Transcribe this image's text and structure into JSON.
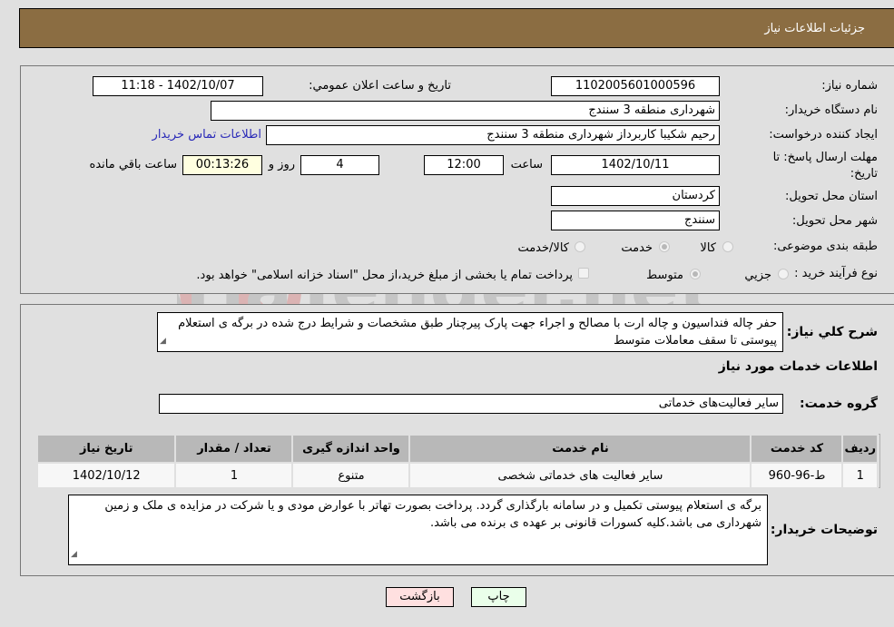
{
  "header": {
    "title": "جزئیات اطلاعات نیاز"
  },
  "fields": {
    "need_number": {
      "label": "شماره نیاز:",
      "value": "1102005601000596"
    },
    "announce": {
      "label": "تاریخ و ساعت اعلان عمومي:",
      "value": "1402/10/07 - 11:18"
    },
    "buyer_org": {
      "label": "نام دستگاه خریدار:",
      "value": "شهرداری منطقه 3 سنندج"
    },
    "requester": {
      "label": "ایجاد کننده درخواست:",
      "value": "رحیم شکیبا کاربرداز شهرداری منطقه 3 سنندج"
    },
    "buyer_contact_link": "اطلاعات تماس خریدار",
    "deadline": {
      "label_line1": "مهلت ارسال پاسخ: تا",
      "label_line2": "تاریخ:",
      "date": "1402/10/11",
      "time_label": "ساعت",
      "time": "12:00",
      "days": "4",
      "days_label": "روز و",
      "remaining": "00:13:26",
      "remaining_label": "ساعت باقي مانده"
    },
    "province": {
      "label": "استان محل تحویل:",
      "value": "کردستان"
    },
    "city": {
      "label": "شهر محل تحویل:",
      "value": "سنندج"
    },
    "category": {
      "label": "طبقه بندی موضوعی:",
      "options": [
        {
          "label": "کالا",
          "checked": false
        },
        {
          "label": "خدمت",
          "checked": true
        },
        {
          "label": "کالا/خدمت",
          "checked": false
        }
      ]
    },
    "process": {
      "label": "نوع فرآیند خرید :",
      "options": [
        {
          "label": "جزيي",
          "checked": false
        },
        {
          "label": "متوسط",
          "checked": true
        }
      ],
      "treasury_checkbox_label": "پرداخت تمام یا بخشی از مبلغ خرید،از محل \"اسناد خزانه اسلامی\" خواهد بود.",
      "treasury_checked": false
    }
  },
  "description": {
    "label": "شرح کلي نیاز:",
    "value": "حفر چاله فنداسیون و چاله ارت با مصالح و اجراء جهت پارک پیرچنار طبق مشخصات و شرایط درج شده در برگه ی استعلام پیوستی تا سقف معاملات متوسط"
  },
  "services_section_title": "اطلاعات خدمات مورد نیاز",
  "service_group": {
    "label": "گروه خدمت:",
    "value": "سایر فعالیت‌های خدماتی"
  },
  "table": {
    "headers": [
      "ردیف",
      "کد خدمت",
      "نام خدمت",
      "واحد اندازه گیری",
      "تعداد / مقدار",
      "تاریخ نیاز"
    ],
    "rows": [
      [
        "1",
        "ط-96-960",
        "سایر فعالیت های خدماتی شخصی",
        "متنوع",
        "1",
        "1402/10/12"
      ]
    ]
  },
  "buyer_notes": {
    "label": "توضیحات خریدار:",
    "value": "برگه ی استعلام پیوستی تکمیل و در سامانه بارگذاری گردد. پرداخت بصورت تهاتر با عوارض مودی و یا شرکت در مزایده ی ملک و زمین شهرداری می باشد.کلیه کسورات قانونی بر عهده ی برنده می باشد."
  },
  "buttons": {
    "print": "چاپ",
    "back": "بازگشت"
  },
  "colors": {
    "header_bg": "#8b6d42",
    "print_bg": "#eaffea",
    "back_bg": "#ffe0e0",
    "remaining_bg": "#ffffe0"
  },
  "watermark": "AriaTender.net"
}
